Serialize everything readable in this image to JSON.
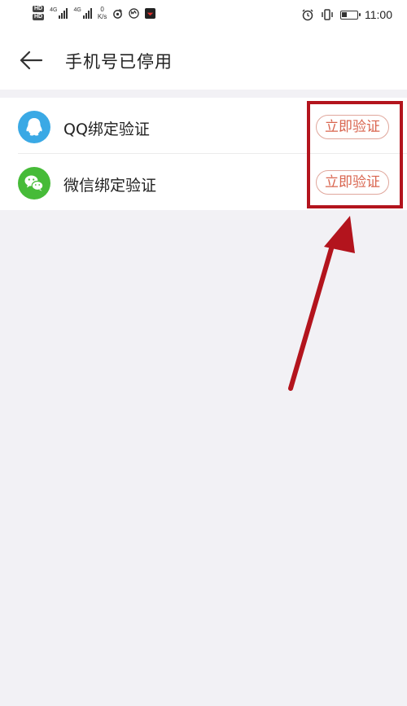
{
  "status_bar": {
    "hd": "HD",
    "net1": "4G",
    "net2": "4G",
    "speed_value": "0",
    "speed_unit": "K/s",
    "time": "11:00"
  },
  "header": {
    "title": "手机号已停用"
  },
  "list": {
    "items": [
      {
        "label": "QQ绑定验证",
        "icon": "qq-icon",
        "button": "立即验证"
      },
      {
        "label": "微信绑定验证",
        "icon": "wechat-icon",
        "button": "立即验证"
      }
    ]
  },
  "colors": {
    "qq_blue": "#3aa9e5",
    "wechat_green": "#46bb38",
    "button_text": "#d9654f",
    "annotation_red": "#b3141d"
  }
}
